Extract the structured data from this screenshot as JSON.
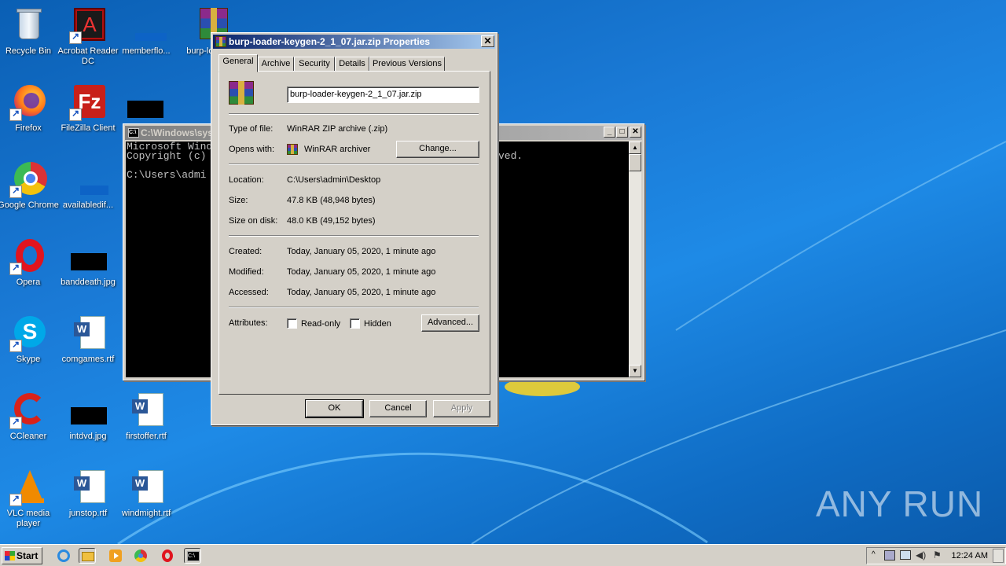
{
  "desktop": {
    "icons": [
      {
        "label": "Recycle Bin"
      },
      {
        "label": "Acrobat Reader DC"
      },
      {
        "label": "memberflo..."
      },
      {
        "label": "burp-loa..."
      },
      {
        "label": "Firefox"
      },
      {
        "label": "FileZilla Client"
      },
      {
        "label": "Google Chrome"
      },
      {
        "label": "availabledif..."
      },
      {
        "label": "Opera"
      },
      {
        "label": "banddeath.jpg"
      },
      {
        "label": "Skype"
      },
      {
        "label": "comgames.rtf"
      },
      {
        "label": "CCleaner"
      },
      {
        "label": "intdvd.jpg"
      },
      {
        "label": "firstoffer.rtf"
      },
      {
        "label": "VLC media player"
      },
      {
        "label": "junstop.rtf"
      },
      {
        "label": "windmight.rtf"
      }
    ],
    "watermark": "ANY RUN"
  },
  "console": {
    "title": "C:\\Windows\\sys",
    "lines": [
      "Microsoft Wind",
      "Copyright (c)",
      "",
      "C:\\Users\\admi"
    ],
    "right_text": "ved."
  },
  "dialog": {
    "title": "burp-loader-keygen-2_1_07.jar.zip Properties",
    "close": "✕",
    "tabs": [
      "General",
      "Archive",
      "Security",
      "Details",
      "Previous Versions"
    ],
    "filename": "burp-loader-keygen-2_1_07.jar.zip",
    "type_label": "Type of file:",
    "type_value": "WinRAR ZIP archive (.zip)",
    "opens_label": "Opens with:",
    "opens_value": "WinRAR archiver",
    "change_button": "Change...",
    "location_label": "Location:",
    "location_value": "C:\\Users\\admin\\Desktop",
    "size_label": "Size:",
    "size_value": "47.8 KB (48,948 bytes)",
    "disk_label": "Size on disk:",
    "disk_value": "48.0 KB (49,152 bytes)",
    "created_label": "Created:",
    "created_value": "Today, January 05, 2020, 1 minute ago",
    "modified_label": "Modified:",
    "modified_value": "Today, January 05, 2020, 1 minute ago",
    "accessed_label": "Accessed:",
    "accessed_value": "Today, January 05, 2020, 1 minute ago",
    "attributes_label": "Attributes:",
    "readonly_label": "Read-only",
    "hidden_label": "Hidden",
    "advanced_button": "Advanced...",
    "ok_button": "OK",
    "cancel_button": "Cancel",
    "apply_button": "Apply"
  },
  "taskbar": {
    "start_label": "Start",
    "clock": "12:24 AM"
  }
}
